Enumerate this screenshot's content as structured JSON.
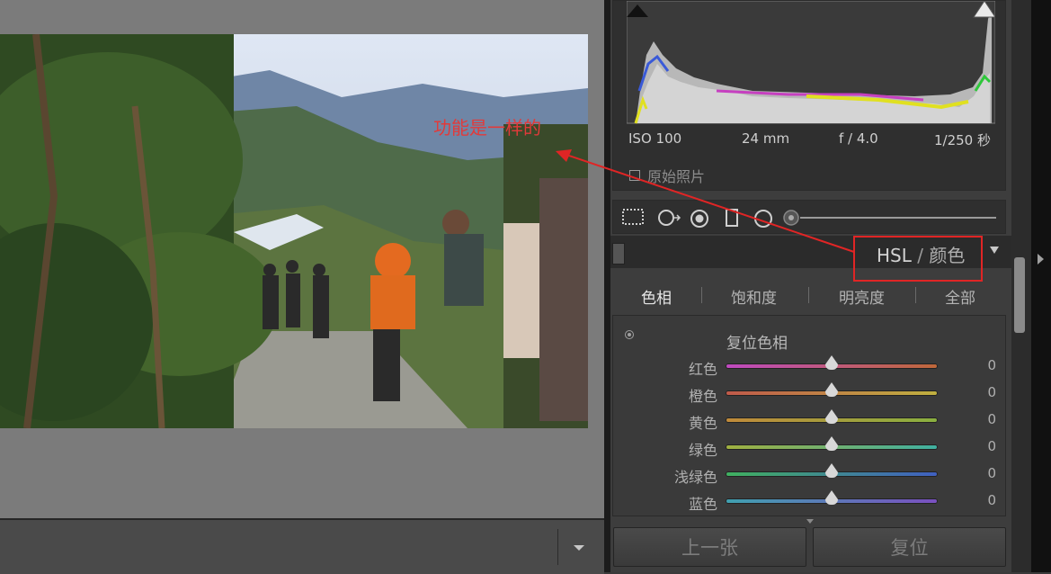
{
  "colors": {
    "accent_red": "#e02525",
    "panel_bg": "#3d3d3d"
  },
  "histogram": {
    "iso": "ISO 100",
    "focal_length": "24 mm",
    "aperture": "f / 4.0",
    "shutter": "1/250 秒",
    "original_photo_label": "原始照片"
  },
  "tools": {
    "icons": [
      "crop-overlay-icon",
      "spot-removal-icon",
      "red-eye-icon",
      "graduated-filter-icon",
      "radial-filter-icon",
      "adjustment-brush-icon"
    ]
  },
  "hsl_panel": {
    "title_hsl": "HSL",
    "title_sep": " / ",
    "title_color": "颜色",
    "tabs": [
      "色相",
      "饱和度",
      "明亮度",
      "全部"
    ],
    "active_tab": "色相",
    "reset_label": "复位色相",
    "sliders": [
      {
        "label": "红色",
        "value": "0",
        "level": 0.5,
        "track": [
          "#c04ac0",
          "#c0683a"
        ]
      },
      {
        "label": "橙色",
        "value": "0",
        "level": 0.5,
        "track": [
          "#c05a4a",
          "#c0b040"
        ]
      },
      {
        "label": "黄色",
        "value": "0",
        "level": 0.5,
        "track": [
          "#c08a3a",
          "#8ab040"
        ]
      },
      {
        "label": "绿色",
        "value": "0",
        "level": 0.5,
        "track": [
          "#a0b040",
          "#40b0a0"
        ]
      },
      {
        "label": "浅绿色",
        "value": "0",
        "level": 0.5,
        "track": [
          "#40b060",
          "#4060c0"
        ]
      },
      {
        "label": "蓝色",
        "value": "0",
        "level": 0.5,
        "track": [
          "#40a0b0",
          "#7a50c0"
        ]
      }
    ]
  },
  "buttons": {
    "previous": "上一张",
    "reset": "复位"
  },
  "annotation": {
    "text": "功能是一样的"
  }
}
